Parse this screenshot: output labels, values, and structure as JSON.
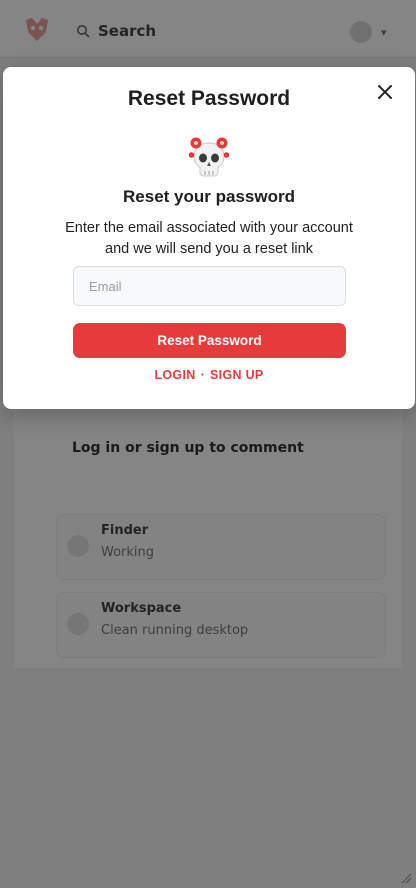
{
  "background": {
    "header": {
      "search_label": "Search"
    },
    "login_prompt": "Log in or sign up to comment",
    "items": [
      {
        "title": "Finder",
        "subtitle": "Working"
      },
      {
        "title": "Workspace",
        "subtitle": "Clean running desktop"
      }
    ]
  },
  "modal": {
    "title": "Reset Password",
    "heading": "Reset your password",
    "description": "Enter the email associated with your account and we will send you a reset link",
    "email_placeholder": "Email",
    "email_value": "",
    "reset_button_label": "Reset Password",
    "login_link": "LOGIN",
    "separator": "·",
    "signup_link": "SIGN UP",
    "close_icon": "close-icon",
    "illustration_icon": "skull-with-red-flowers-icon"
  },
  "colors": {
    "accent": "#e63b3c",
    "overlay": "rgba(0,0,0,0.48)"
  }
}
